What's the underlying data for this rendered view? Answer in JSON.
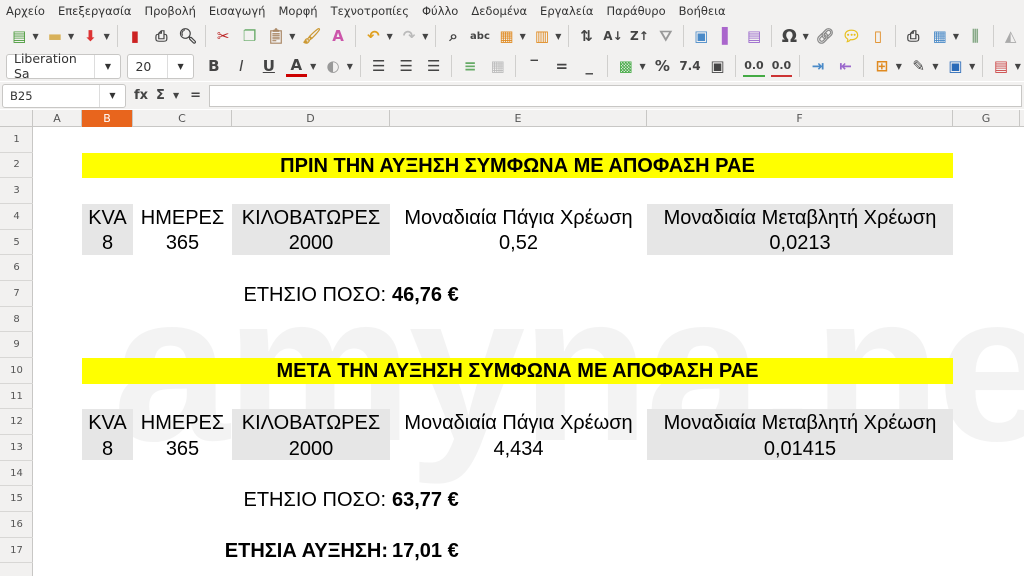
{
  "menu": [
    "Αρχείο",
    "Επεξεργασία",
    "Προβολή",
    "Εισαγωγή",
    "Μορφή",
    "Τεχνοτροπίες",
    "Φύλλο",
    "Δεδομένα",
    "Εργαλεία",
    "Παράθυρο",
    "Βοήθεια"
  ],
  "toolbar": {
    "font_name": "Liberation Sa",
    "font_size": "20",
    "bold": "B",
    "italic": "I",
    "underline": "U",
    "font_color": "A",
    "percent": "%",
    "number": "7.4",
    "add_decimal": "0.0",
    "del_decimal": "0.0",
    "special_char": "Ω",
    "sort_asc": "A↓",
    "sort_desc": "Z↑"
  },
  "formula_bar": {
    "cell_ref": "B25",
    "fx": "fx",
    "sum": "Σ",
    "equals": "=",
    "value": ""
  },
  "columns": [
    "A",
    "B",
    "C",
    "D",
    "E",
    "F",
    "G"
  ],
  "selected_column": "B",
  "rows": [
    "1",
    "2",
    "3",
    "4",
    "5",
    "6",
    "7",
    "8",
    "9",
    "10",
    "11",
    "12",
    "13",
    "14",
    "15",
    "16",
    "17"
  ],
  "watermark": "amyna.news",
  "sheet": {
    "title_before": "ΠΡΙΝ ΤΗΝ ΑΥΞΗΣΗ ΣΥΜΦΩΝΑ ΜΕ ΑΠΟΦΑΣΗ ΡΑΕ",
    "title_after": "ΜΕΤΑ ΤΗΝ ΑΥΞΗΣΗ ΣΥΜΦΩΝΑ ΜΕ ΑΠΟΦΑΣΗ ΡΑΕ",
    "headers": [
      "KVA",
      "ΗΜΕΡΕΣ",
      "ΚΙΛΟΒΑΤΩΡΕΣ",
      "Μοναδιαία Πάγια Χρέωση",
      "Μοναδιαία Μεταβλητή Χρέωση"
    ],
    "before": [
      "8",
      "365",
      "2000",
      "0,52",
      "0,0213"
    ],
    "after": [
      "8",
      "365",
      "2000",
      "4,434",
      "0,01415"
    ],
    "annual_label": "ΕΤΗΣΙΟ ΠΟΣΟ:",
    "annual_before": "46,76 €",
    "annual_after": "63,77 €",
    "increase_label": "ΕΤΗΣΙΑ ΑΥΞΗΣΗ:",
    "increase_value": "17,01 €"
  },
  "colors": {
    "highlight": "#ffff00",
    "selected_header": "#e8651d",
    "shaded_cell": "#e6e6e6"
  }
}
